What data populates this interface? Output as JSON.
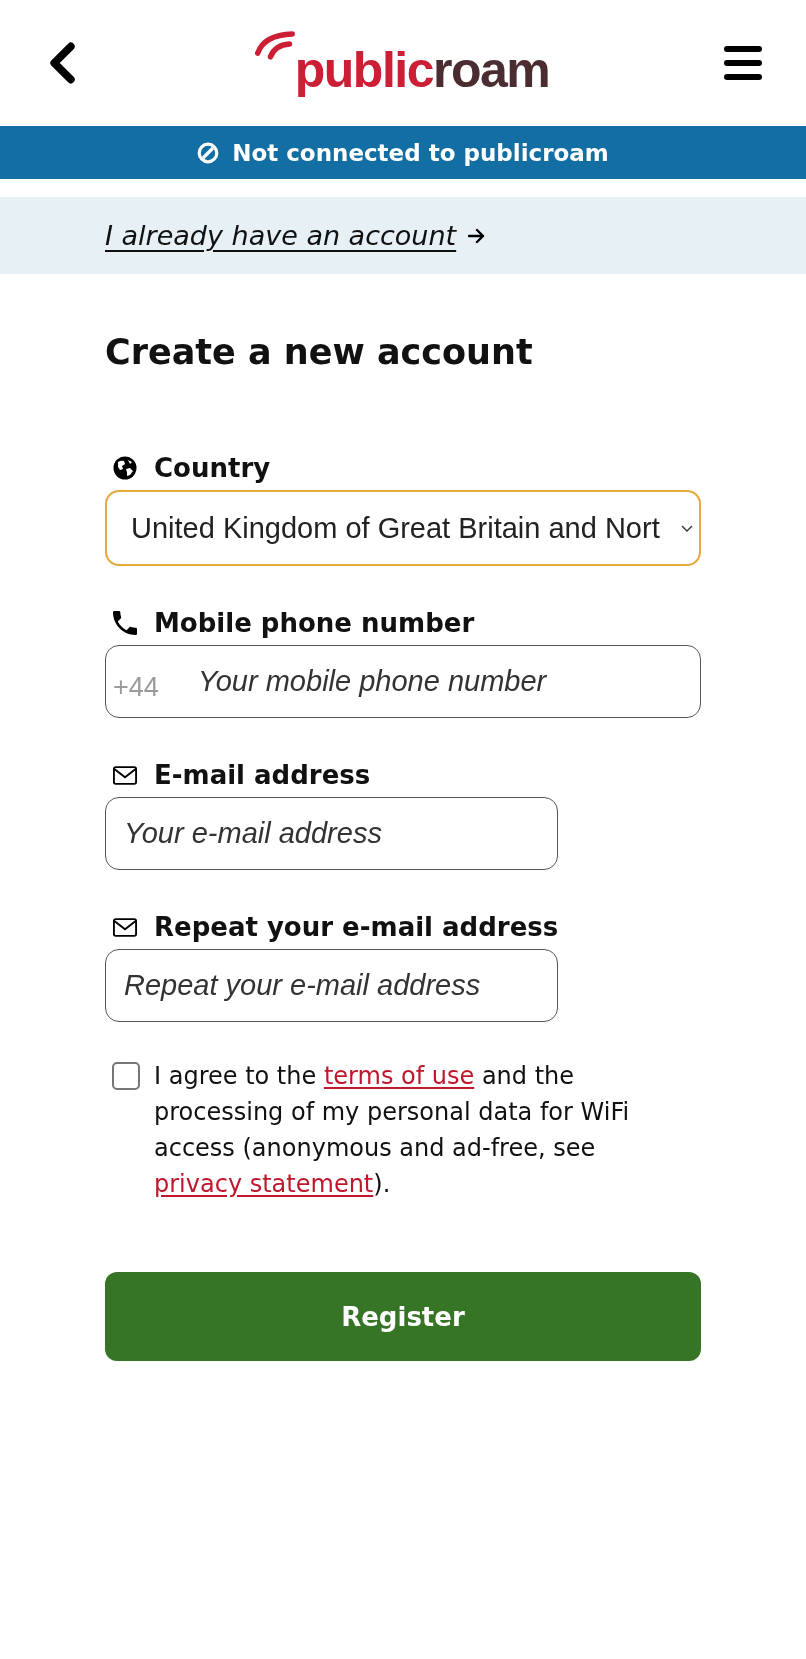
{
  "header": {
    "logo": {
      "primary": "public",
      "secondary": "roam"
    }
  },
  "status_banner": {
    "text": "Not connected to publicroam"
  },
  "login_link": {
    "text": "I already have an account"
  },
  "heading": "Create a new account",
  "fields": [
    {
      "kind": "select",
      "label": "Country",
      "value": "United Kingdom of Great Britain and Nort",
      "focused": true
    },
    {
      "kind": "phone",
      "label": "Mobile phone number",
      "prefix": "+44",
      "placeholder": "Your mobile phone number",
      "focused": false
    },
    {
      "kind": "email",
      "label": "E-mail address",
      "placeholder": "Your e-mail address",
      "focused": false
    },
    {
      "kind": "email",
      "label": "Repeat your e-mail address",
      "placeholder": "Repeat your e-mail address",
      "focused": false
    }
  ],
  "consent": {
    "checked": false,
    "parts": [
      {
        "kind": "text",
        "text": "I agree to the "
      },
      {
        "kind": "link",
        "text": "terms of use"
      },
      {
        "kind": "text",
        "text": " and the processing of my personal data for WiFi access (anonymous and ad-free, see "
      },
      {
        "kind": "link",
        "text": "privacy statement"
      },
      {
        "kind": "text",
        "text": ")."
      }
    ]
  },
  "register_button": {
    "label": "Register"
  }
}
